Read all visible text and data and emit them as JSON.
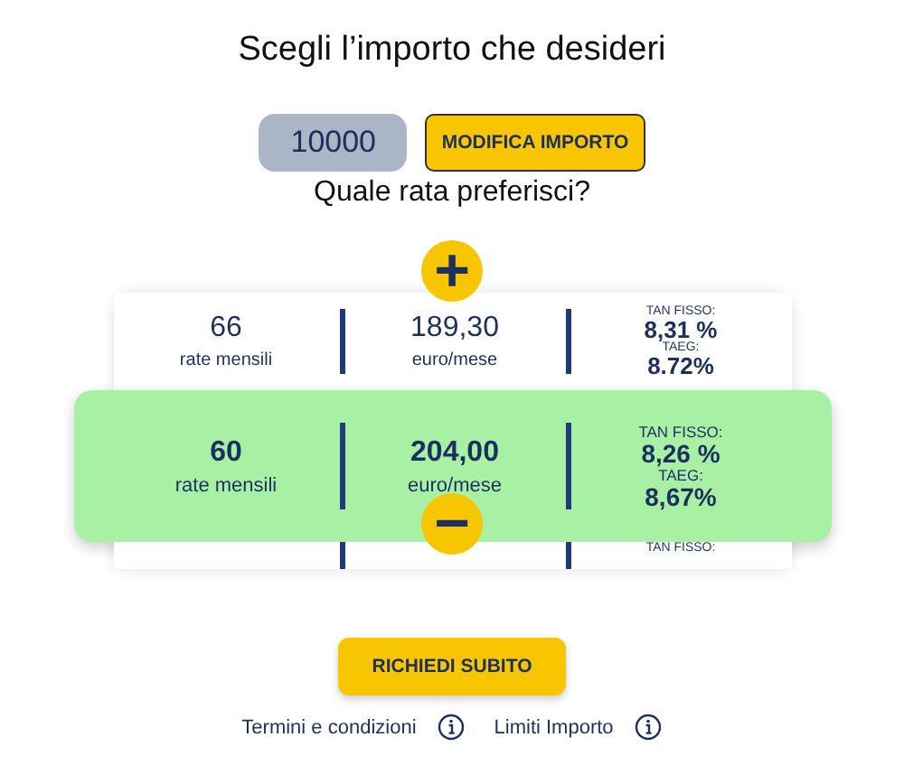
{
  "title": "Scegli l’importo che desideri",
  "amount": {
    "value": "10000",
    "button": "MODIFICA IMPORTO"
  },
  "question": "Quale rata preferisci?",
  "increase_button": "+",
  "decrease_button": "−",
  "rows": [
    {
      "kind": "full",
      "selected": false,
      "months": "66",
      "months_label": "rate mensili",
      "amount": "189,30",
      "amount_label": "euro/mese",
      "tan_label": "TAN FISSO:",
      "tan": "8,31 %",
      "taeg_label": "TAEG:",
      "taeg": "8.72%"
    },
    {
      "kind": "full",
      "selected": true,
      "months": "60",
      "months_label": "rate mensili",
      "amount": "204,00",
      "amount_label": "euro/mese",
      "tan_label": "TAN FISSO:",
      "tan": "8,26 %",
      "taeg_label": "TAEG:",
      "taeg": "8,67%"
    },
    {
      "kind": "partial",
      "selected": false,
      "tan_label": "TAN FISSO:"
    }
  ],
  "submit": "RICHIEDI SUBITO",
  "links": [
    "Termini e condizioni",
    "Limiti Importo"
  ]
}
